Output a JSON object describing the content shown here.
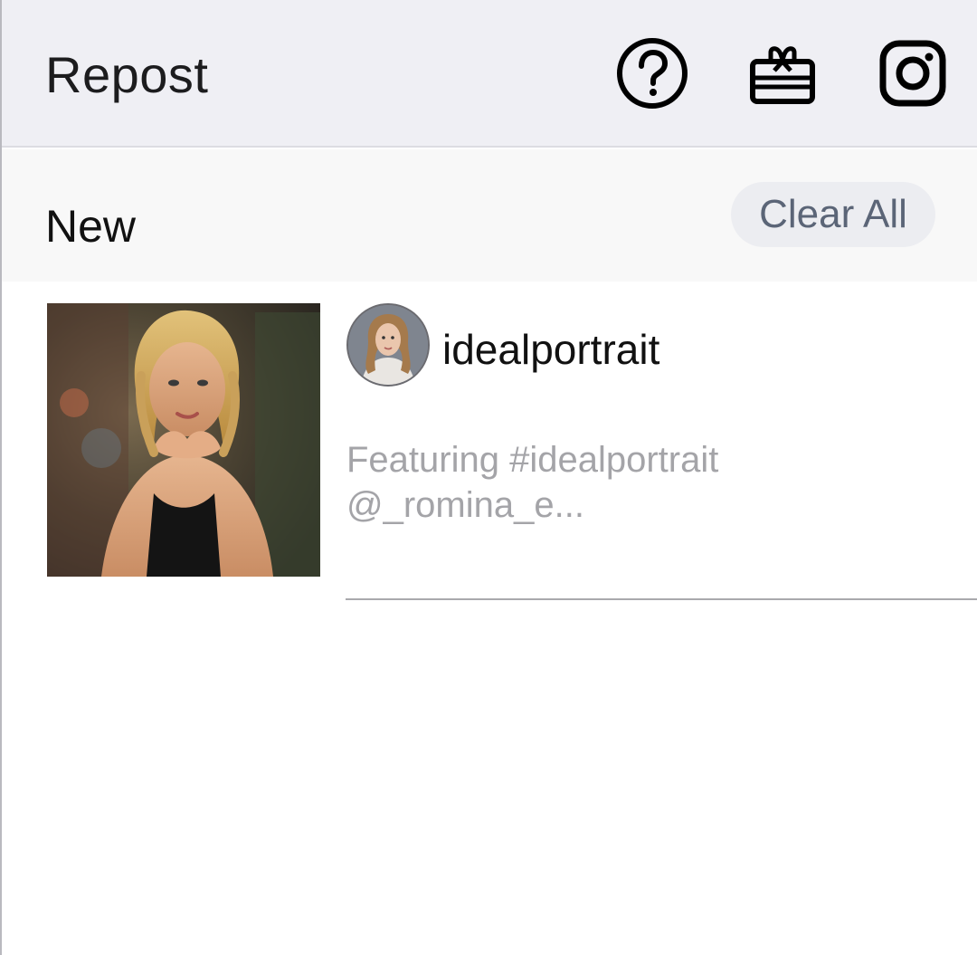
{
  "appbar": {
    "title": "Repost",
    "icons": [
      "help-circle-icon",
      "gift-card-icon",
      "instagram-icon"
    ]
  },
  "section": {
    "title": "New",
    "clear_all_label": "Clear All"
  },
  "items": [
    {
      "username": "idealportrait",
      "caption_line1": "Featuring #idealportrait",
      "caption_line2": "@_romina_e..."
    }
  ],
  "colors": {
    "appbar_bg": "#efeff4",
    "section_bg": "#f8f8f8",
    "clear_all_bg": "#ecedf1",
    "clear_all_text": "#5b6577",
    "caption_text": "#a4a4a8"
  }
}
